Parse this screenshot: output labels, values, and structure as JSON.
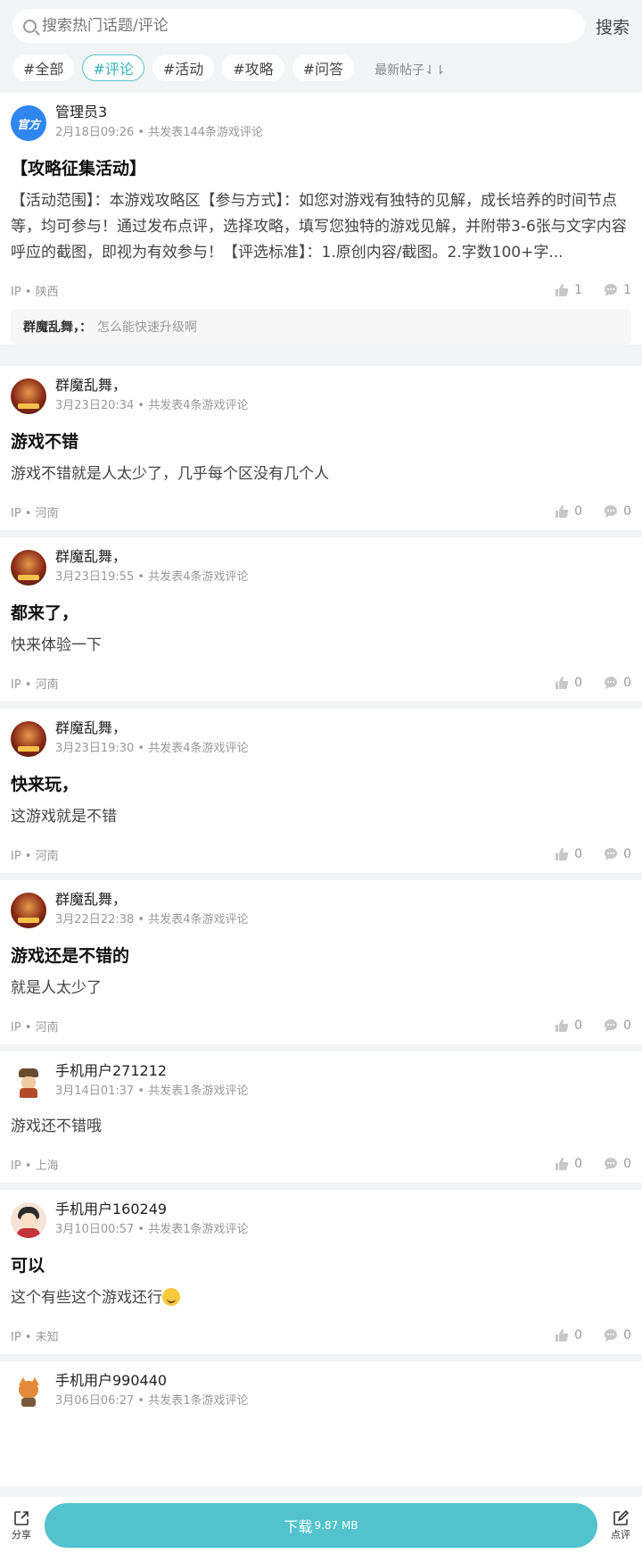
{
  "search": {
    "placeholder": "搜索热门话题/评论",
    "button_label": "搜索"
  },
  "tags": [
    "#全部",
    "#评论",
    "#活动",
    "#攻略",
    "#问答"
  ],
  "sort_label": "最新帖子⇃⇂",
  "posts": [
    {
      "user": "管理员3",
      "meta": "2月18日09:26 • 共发表144条游戏评论",
      "avatar_text": "官方",
      "title": "【攻略征集活动】",
      "body": "【活动范围】：本游戏攻略区【参与方式】：如您对游戏有独特的见解，成长培养的时间节点等，均可参与！通过发布点评，选择攻略，填写您独特的游戏见解，并附带3-6张与文字内容呼应的截图，即视为有效参与！【评选标准】：1.原创内容/截图。2.字数100+字...",
      "ip": "IP • 陕西",
      "likes": "1",
      "comments": "1",
      "reply_user": "群魔乱舞，：",
      "reply_text": "怎么能快速升级啊"
    },
    {
      "user": "群魔乱舞，",
      "meta": "3月23日20:34 • 共发表4条游戏评论",
      "title": "游戏不错",
      "body": "游戏不错就是人太少了，几乎每个区没有几个人",
      "ip": "IP • 河南",
      "likes": "0",
      "comments": "0"
    },
    {
      "user": "群魔乱舞，",
      "meta": "3月23日19:55 • 共发表4条游戏评论",
      "title": "都来了，",
      "body": "快来体验一下",
      "ip": "IP • 河南",
      "likes": "0",
      "comments": "0"
    },
    {
      "user": "群魔乱舞，",
      "meta": "3月23日19:30 • 共发表4条游戏评论",
      "title": "快来玩，",
      "body": "这游戏就是不错",
      "ip": "IP • 河南",
      "likes": "0",
      "comments": "0"
    },
    {
      "user": "群魔乱舞，",
      "meta": "3月22日22:38 • 共发表4条游戏评论",
      "title": "游戏还是不错的",
      "body": "就是人太少了",
      "ip": "IP • 河南",
      "likes": "0",
      "comments": "0"
    },
    {
      "user": "手机用户271212",
      "meta": "3月14日01:37 • 共发表1条游戏评论",
      "body": "游戏还不错哦",
      "ip": "IP • 上海",
      "likes": "0",
      "comments": "0"
    },
    {
      "user": "手机用户160249",
      "meta": "3月10日00:57 • 共发表1条游戏评论",
      "title": "可以",
      "body": "这个有些这个游戏还行",
      "ip": "IP • 未知",
      "likes": "0",
      "comments": "0"
    },
    {
      "user": "手机用户990440",
      "meta": "3月06日06:27 • 共发表1条游戏评论"
    }
  ],
  "bottom": {
    "share_label": "分享",
    "review_label": "点评",
    "download_label": "下载",
    "download_size": "9.87 MB"
  },
  "colors": {
    "accent": "#52c3cc",
    "official_avatar": "#2f86f0"
  }
}
